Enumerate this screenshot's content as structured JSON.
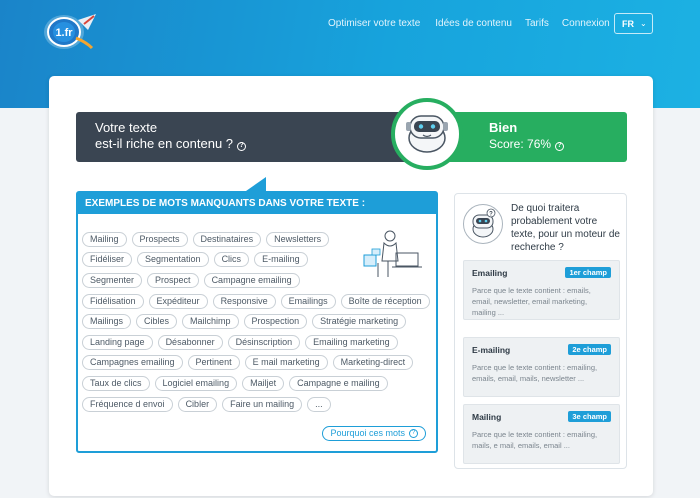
{
  "header": {
    "logo_text": "1.fr",
    "nav": [
      "Optimiser votre texte",
      "Idées de contenu",
      "Tarifs",
      "Connexion"
    ],
    "lang": "FR",
    "lang_chevron": "chevron-down-icon"
  },
  "banner": {
    "question_line1": "Votre texte",
    "question_line2": "est-il riche en contenu ?",
    "rating": "Bien",
    "score": "Score: 76%",
    "help_icon": "question-circle-icon",
    "colors": {
      "dark": "#3a4552",
      "good": "#27ae60"
    }
  },
  "missing_words": {
    "title": "EXEMPLES DE MOTS MANQUANTS DANS VOTRE TEXTE :",
    "rows": [
      [
        "Mailing",
        "Prospects",
        "Destinataires",
        "Newsletters"
      ],
      [
        "Fidéliser",
        "Segmentation",
        "Clics",
        "E-mailing"
      ],
      [
        "Segmenter",
        "Prospect",
        "Campagne emailing"
      ],
      [
        "Fidélisation",
        "Expéditeur",
        "Responsive",
        "Emailings",
        "Boîte de réception"
      ],
      [
        "Mailings",
        "Cibles",
        "Mailchimp",
        "Prospection",
        "Stratégie marketing"
      ],
      [
        "Landing page",
        "Désabonner",
        "Désinscription",
        "Emailing marketing"
      ],
      [
        "Campagnes emailing",
        "Pertinent",
        "E mail marketing",
        "Marketing-direct"
      ],
      [
        "Taux de clics",
        "Logiciel emailing",
        "Mailjet",
        "Campagne e mailing"
      ],
      [
        "Fréquence d envoi",
        "Cibler",
        "Faire un mailing",
        "..."
      ]
    ],
    "why_button": "Pourquoi ces mots"
  },
  "topics": {
    "question": "De quoi traitera probablement votre texte, pour un moteur de recherche ?",
    "items": [
      {
        "name": "Emailing",
        "rank": "1er champ",
        "desc": "Parce que le texte contient : emails, email, newsletter, email marketing, mailing ..."
      },
      {
        "name": "E-mailing",
        "rank": "2e champ",
        "desc": "Parce que le texte contient : emailing, emails, email, mails, newsletter ..."
      },
      {
        "name": "Mailing",
        "rank": "3e champ",
        "desc": "Parce que le texte contient : emailing, mails, e mail, emails, email ..."
      }
    ]
  }
}
